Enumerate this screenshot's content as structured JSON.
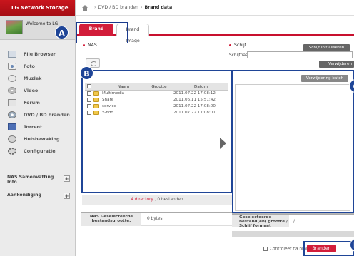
{
  "sidebar": {
    "brand": "LG Network Storage",
    "welcome": "Welcome to LG Network Storage",
    "items": [
      {
        "label": "File Browser",
        "icon": "file-browser-icon"
      },
      {
        "label": "Foto",
        "icon": "photo-icon"
      },
      {
        "label": "Muziek",
        "icon": "music-icon"
      },
      {
        "label": "Video",
        "icon": "video-icon"
      },
      {
        "label": "Forum",
        "icon": "forum-icon"
      },
      {
        "label": "DVD / BD branden",
        "icon": "disc-icon"
      },
      {
        "label": "Torrent",
        "icon": "torrent-icon"
      },
      {
        "label": "Huisbewaking",
        "icon": "camera-icon"
      },
      {
        "label": "Configuratie",
        "icon": "config-icon"
      }
    ],
    "summary_box": "NAS Samenvatting Info",
    "notice_box": "Aankondiging"
  },
  "breadcrumb": {
    "section": "DVD / BD branden",
    "current": "Brand data"
  },
  "tabs": [
    {
      "label": "Brand data",
      "active": true
    },
    {
      "label": "Brand Image",
      "active": false
    }
  ],
  "nas": {
    "heading": "NAS",
    "columns": [
      "Naam",
      "Grootte",
      "Datum"
    ],
    "rows": [
      {
        "name": "Multimedia",
        "size": "",
        "date": "2011.07.22 17:08:12"
      },
      {
        "name": "Share",
        "size": "",
        "date": "2011.06.11 15:51:42"
      },
      {
        "name": "service",
        "size": "",
        "date": "2011.07.22 17:08:00"
      },
      {
        "name": "x-fidd",
        "size": "",
        "date": "2011.07.22 17:08:01"
      }
    ],
    "summary_count": "4 directory",
    "summary_rest": " , 0 bestanden",
    "size_label": "NAS Geselecteerde bestandsgrootte:",
    "size_value": "0 bytes"
  },
  "schijf": {
    "heading": "Schijf",
    "init_button": "Schijf initialiseren",
    "name_label": "Schijfnaam",
    "name_value": "",
    "remove_button": "Verwijderen",
    "delete_batch_button": "Verwijdering batch",
    "selected_label": "Geselecteerde bestand(en) grootte / Schijf formaat",
    "selected_value": "/",
    "progress": 0
  },
  "footer": {
    "check_label": "Controleer na branden",
    "burn_button": "Branden"
  },
  "callouts": [
    "A",
    "B",
    "C",
    "D"
  ],
  "colors": {
    "accent": "#d21d3a",
    "callout": "#1f4597"
  }
}
